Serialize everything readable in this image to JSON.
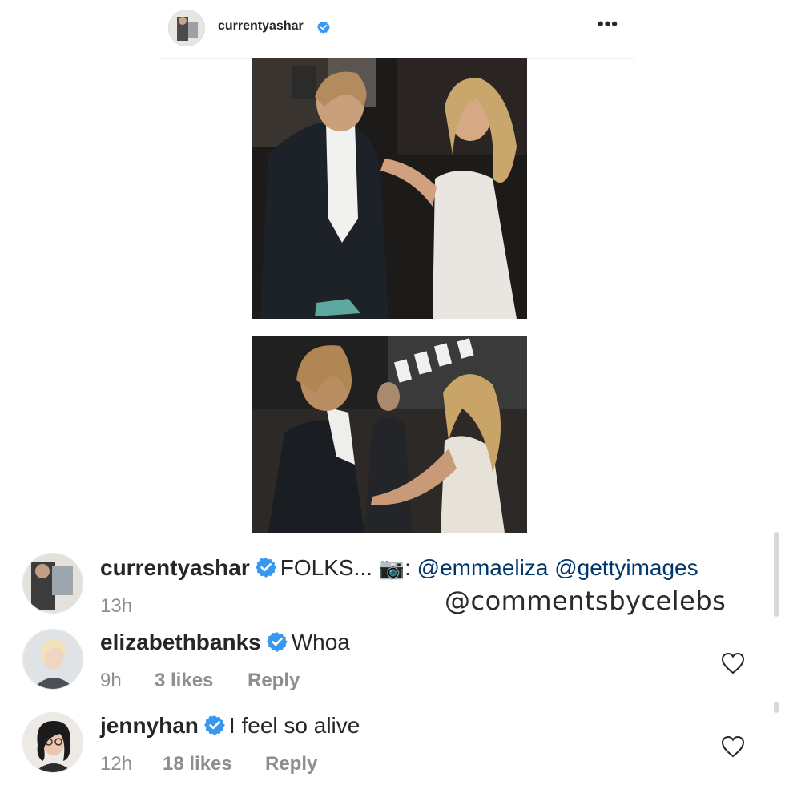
{
  "post": {
    "username": "currentyashar",
    "more_icon": "more-horizontal-icon"
  },
  "comments": [
    {
      "username": "currentyashar",
      "text": "FOLKS... ",
      "camera_icon": "📷",
      "credit_sep": ": ",
      "mentions": "@emmaeliza @gettyimages",
      "time": "13h"
    },
    {
      "username": "elizabethbanks",
      "text": "Whoa",
      "time": "9h",
      "likes": "3 likes",
      "reply": "Reply"
    },
    {
      "username": "jennyhan",
      "text": "I feel so alive",
      "time": "12h",
      "likes": "18 likes",
      "reply": "Reply"
    }
  ],
  "watermark": "@commentsbycelebs",
  "colors": {
    "verified": "#3897f0",
    "mention": "#00376b",
    "meta": "#8e8e8e"
  }
}
